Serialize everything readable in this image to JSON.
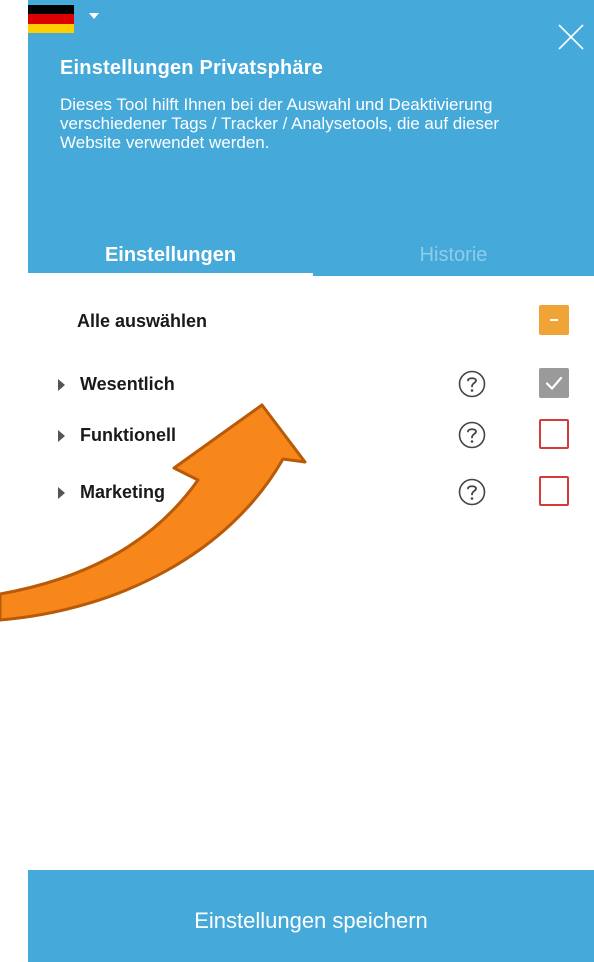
{
  "header": {
    "language": "Deutsch",
    "title": "Einstellungen Privatsphäre",
    "description": "Dieses Tool hilft Ihnen bei der Auswahl und Deaktivierung verschiedener Tags / Tracker / Analysetools, die auf dieser Website verwendet werden."
  },
  "tabs": {
    "settings": "Einstellungen",
    "history": "Historie",
    "active": "Einstellungen"
  },
  "select_all": {
    "label": "Alle auswählen",
    "state": "partial"
  },
  "categories": [
    {
      "label": "Wesentlich",
      "checked": true,
      "disabled": true
    },
    {
      "label": "Funktionell",
      "checked": false
    },
    {
      "label": "Marketing",
      "checked": false
    }
  ],
  "footer": {
    "save_label": "Einstellungen speichern"
  },
  "colors": {
    "primary": "#45a9d9",
    "partial_checkbox": "#f0a336",
    "unchecked_border": "#d63b3b",
    "checked_disabled": "#9a9a9a",
    "annotation_arrow": "#f7861b"
  },
  "icons": {
    "close": "close-icon",
    "help": "question-circle-icon",
    "expand": "caret-right-icon",
    "language": "german-flag-icon"
  }
}
